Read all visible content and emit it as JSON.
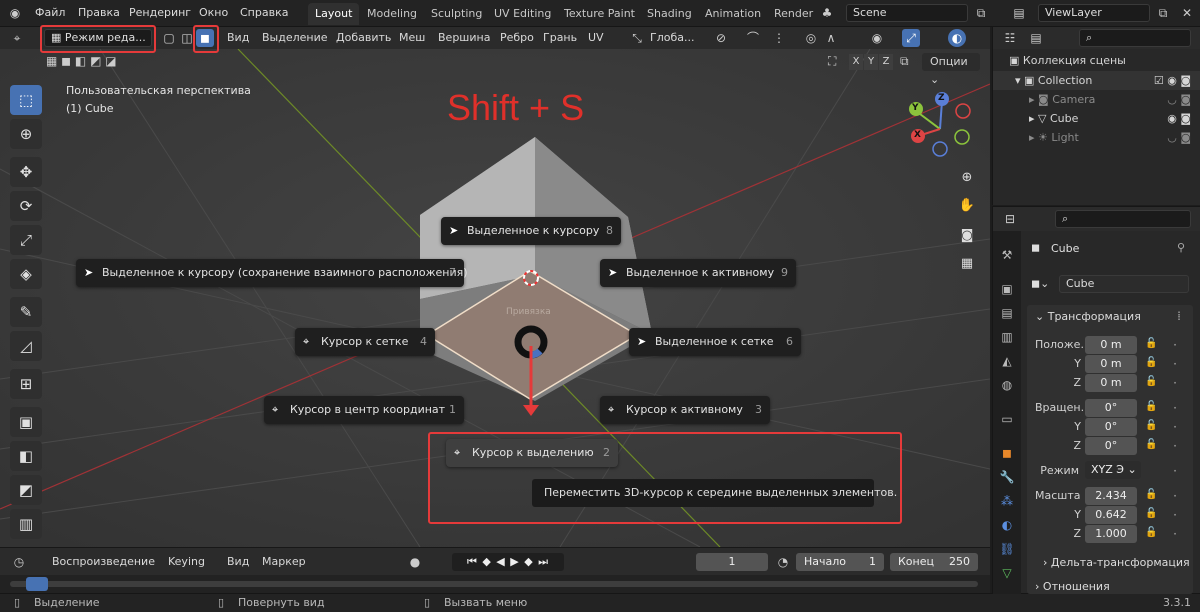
{
  "topbar": {
    "menu": [
      "Файл",
      "Правка",
      "Рендеринг",
      "Окно",
      "Справка"
    ],
    "workspaces": [
      "Layout",
      "Modeling",
      "Sculpting",
      "UV Editing",
      "Texture Paint",
      "Shading",
      "Animation",
      "Render"
    ],
    "scene": "Scene",
    "viewlayer": "ViewLayer"
  },
  "viewport_header": {
    "mode": "Режим реда...",
    "menu": [
      "Вид",
      "Выделение",
      "Добавить",
      "Меш",
      "Вершина",
      "Ребро",
      "Грань",
      "UV"
    ],
    "orientation": "Глоба...",
    "axes": [
      "X",
      "Y",
      "Z"
    ],
    "options": "Опции"
  },
  "viewport": {
    "view_name": "Пользовательская перспектива",
    "object_name": "(1) Cube",
    "shortcut": "Shift + S",
    "pie_title": "Привязка",
    "pie_items": [
      {
        "label": "Выделенное к курсору",
        "num": "8",
        "icon": "pointer-icon"
      },
      {
        "label": "Выделенное к курсору (сохранение взаимного расположения)",
        "num": "7",
        "icon": "pointer-icon"
      },
      {
        "label": "Выделенное к активному",
        "num": "9",
        "icon": "pointer-icon"
      },
      {
        "label": "Курсор к сетке",
        "num": "4",
        "icon": "cursor-icon"
      },
      {
        "label": "Выделенное к сетке",
        "num": "6",
        "icon": "pointer-icon"
      },
      {
        "label": "Курсор в центр координат",
        "num": "1",
        "icon": "cursor-icon"
      },
      {
        "label": "Курсор к активному",
        "num": "3",
        "icon": "cursor-icon"
      },
      {
        "label": "Курсор к выделению",
        "num": "2",
        "icon": "cursor-icon"
      }
    ],
    "tooltip": "Переместить 3D-курсор к середине выделенных элементов.",
    "gizmo": {
      "x": "X",
      "y": "Y",
      "z": "Z"
    }
  },
  "timeline": {
    "items": [
      "Воспроизведение",
      "Keying",
      "Вид",
      "Маркер"
    ],
    "current_frame": "1",
    "start_label": "Начало",
    "start": "1",
    "end_label": "Конец",
    "end": "250"
  },
  "statusbar": {
    "select": "Выделение",
    "rotate": "Повернуть вид",
    "menu": "Вызвать меню",
    "version": "3.3.1"
  },
  "outliner": {
    "scene_collection": "Коллекция сцены",
    "items": [
      "Collection",
      "Camera",
      "Cube",
      "Light"
    ]
  },
  "properties": {
    "object_name": "Cube",
    "data_name": "Cube",
    "section_transform": "Трансформация",
    "location_label": "Положе...",
    "location": [
      "0 m",
      "0 m",
      "0 m"
    ],
    "rotation_label": "Вращен...",
    "rotation": [
      "0°",
      "0°",
      "0°"
    ],
    "mode_label": "Режим",
    "mode_value": "XYZ Э",
    "scale_label": "Масшта",
    "scale": [
      "2.434",
      "0.642",
      "1.000"
    ],
    "axis_y": "Y",
    "axis_z": "Z",
    "delta": "Дельта-трансформация",
    "relations": "Отношения"
  },
  "colors": {
    "accent": "#4772b3",
    "highlight_red": "#e53a3a",
    "shortcut_text": "#e0302a"
  }
}
